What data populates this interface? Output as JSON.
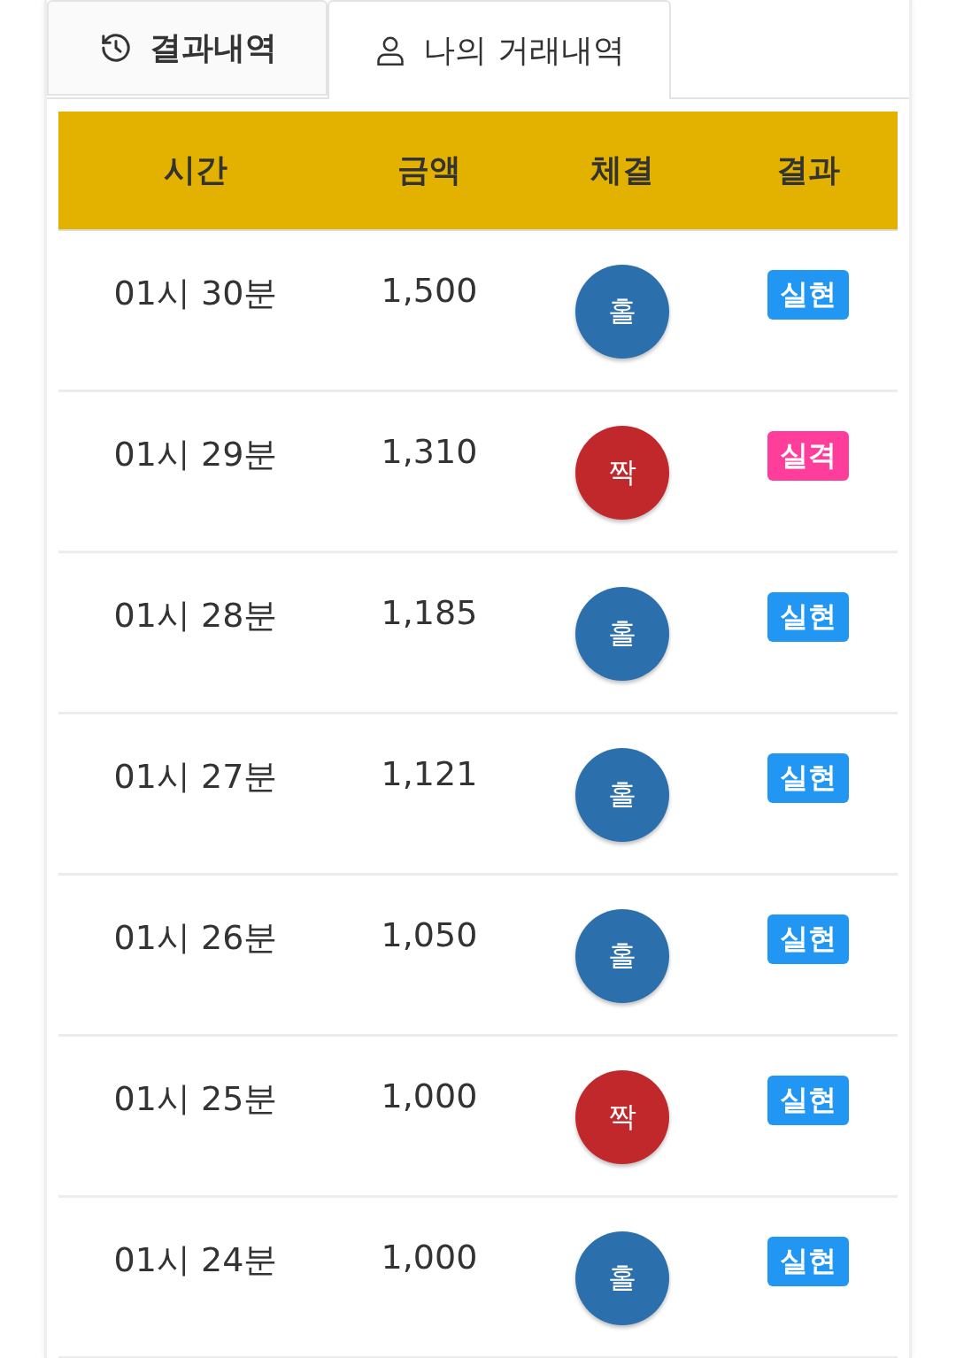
{
  "tabs": [
    {
      "label": "결과내역",
      "kind": "history",
      "selected": false
    },
    {
      "label": "나의 거래내역",
      "kind": "user",
      "selected": true
    }
  ],
  "table": {
    "columns": [
      "시간",
      "금액",
      "체결",
      "결과"
    ],
    "rows": [
      {
        "time": "01시 30분",
        "amount": "1,500",
        "trade": {
          "label": "홀",
          "kind": "odd"
        },
        "result": {
          "label": "실현",
          "kind": "win"
        }
      },
      {
        "time": "01시 29분",
        "amount": "1,310",
        "trade": {
          "label": "짝",
          "kind": "even"
        },
        "result": {
          "label": "실격",
          "kind": "lose"
        }
      },
      {
        "time": "01시 28분",
        "amount": "1,185",
        "trade": {
          "label": "홀",
          "kind": "odd"
        },
        "result": {
          "label": "실현",
          "kind": "win"
        }
      },
      {
        "time": "01시 27분",
        "amount": "1,121",
        "trade": {
          "label": "홀",
          "kind": "odd"
        },
        "result": {
          "label": "실현",
          "kind": "win"
        }
      },
      {
        "time": "01시 26분",
        "amount": "1,050",
        "trade": {
          "label": "홀",
          "kind": "odd"
        },
        "result": {
          "label": "실현",
          "kind": "win"
        }
      },
      {
        "time": "01시 25분",
        "amount": "1,000",
        "trade": {
          "label": "짝",
          "kind": "even"
        },
        "result": {
          "label": "실현",
          "kind": "win"
        }
      },
      {
        "time": "01시 24분",
        "amount": "1,000",
        "trade": {
          "label": "홀",
          "kind": "odd"
        },
        "result": {
          "label": "실현",
          "kind": "win"
        }
      }
    ]
  }
}
